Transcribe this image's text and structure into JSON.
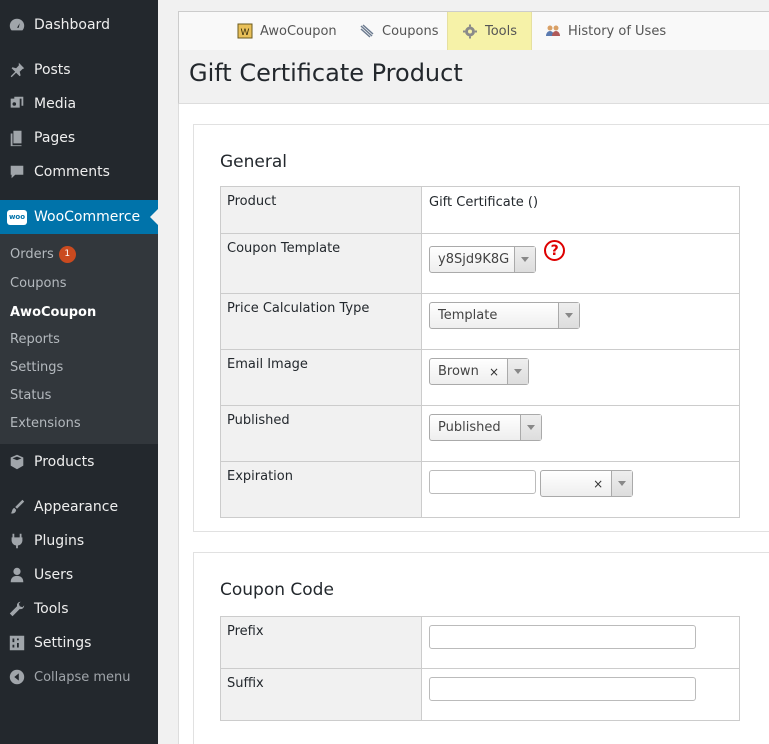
{
  "sidebar": {
    "top_items": [
      {
        "label": "Dashboard",
        "icon": "dashboard-icon"
      },
      {
        "label": "Posts",
        "icon": "pin-icon"
      },
      {
        "label": "Media",
        "icon": "media-icon"
      },
      {
        "label": "Pages",
        "icon": "pages-icon"
      },
      {
        "label": "Comments",
        "icon": "comments-icon"
      }
    ],
    "woocommerce": {
      "label": "WooCommerce",
      "logo_text": "woo"
    },
    "submenu": [
      {
        "label": "Orders",
        "badge": "1"
      },
      {
        "label": "Coupons"
      },
      {
        "label": "AwoCoupon"
      },
      {
        "label": "Reports"
      },
      {
        "label": "Settings"
      },
      {
        "label": "Status"
      },
      {
        "label": "Extensions"
      }
    ],
    "bottom_items": [
      {
        "label": "Products",
        "icon": "products-icon"
      },
      {
        "label": "Appearance",
        "icon": "appearance-icon"
      },
      {
        "label": "Plugins",
        "icon": "plugins-icon"
      },
      {
        "label": "Users",
        "icon": "users-icon"
      },
      {
        "label": "Tools",
        "icon": "wrench-icon"
      },
      {
        "label": "Settings",
        "icon": "settings-icon"
      }
    ],
    "collapse_label": "Collapse menu"
  },
  "tabs": [
    {
      "label": "AwoCoupon",
      "icon": "awocoupon-logo-icon"
    },
    {
      "label": "Coupons",
      "icon": "coupons-icon"
    },
    {
      "label": "Tools",
      "icon": "gear-icon",
      "active": true
    },
    {
      "label": "History of Uses",
      "icon": "people-icon"
    }
  ],
  "page_title": "Gift Certificate Product",
  "general": {
    "heading": "General",
    "product_label": "Product",
    "product_value": "Gift Certificate ()",
    "coupon_template_label": "Coupon Template",
    "coupon_template_value": "y8Sjd9K8G",
    "price_calc_label": "Price Calculation Type",
    "price_calc_value": "Template",
    "email_image_label": "Email Image",
    "email_image_value": "Brown",
    "published_label": "Published",
    "published_value": "Published",
    "expiration_label": "Expiration",
    "expiration_value": "",
    "expiration_unit": ""
  },
  "coupon_code": {
    "heading": "Coupon Code",
    "prefix_label": "Prefix",
    "prefix_value": "",
    "suffix_label": "Suffix",
    "suffix_value": ""
  },
  "colors": {
    "sidebar_bg": "#23282d",
    "submenu_bg": "#32373c",
    "accent": "#0073aa",
    "active_tab": "#f6f2a8",
    "badge": "#ca4a1f"
  }
}
